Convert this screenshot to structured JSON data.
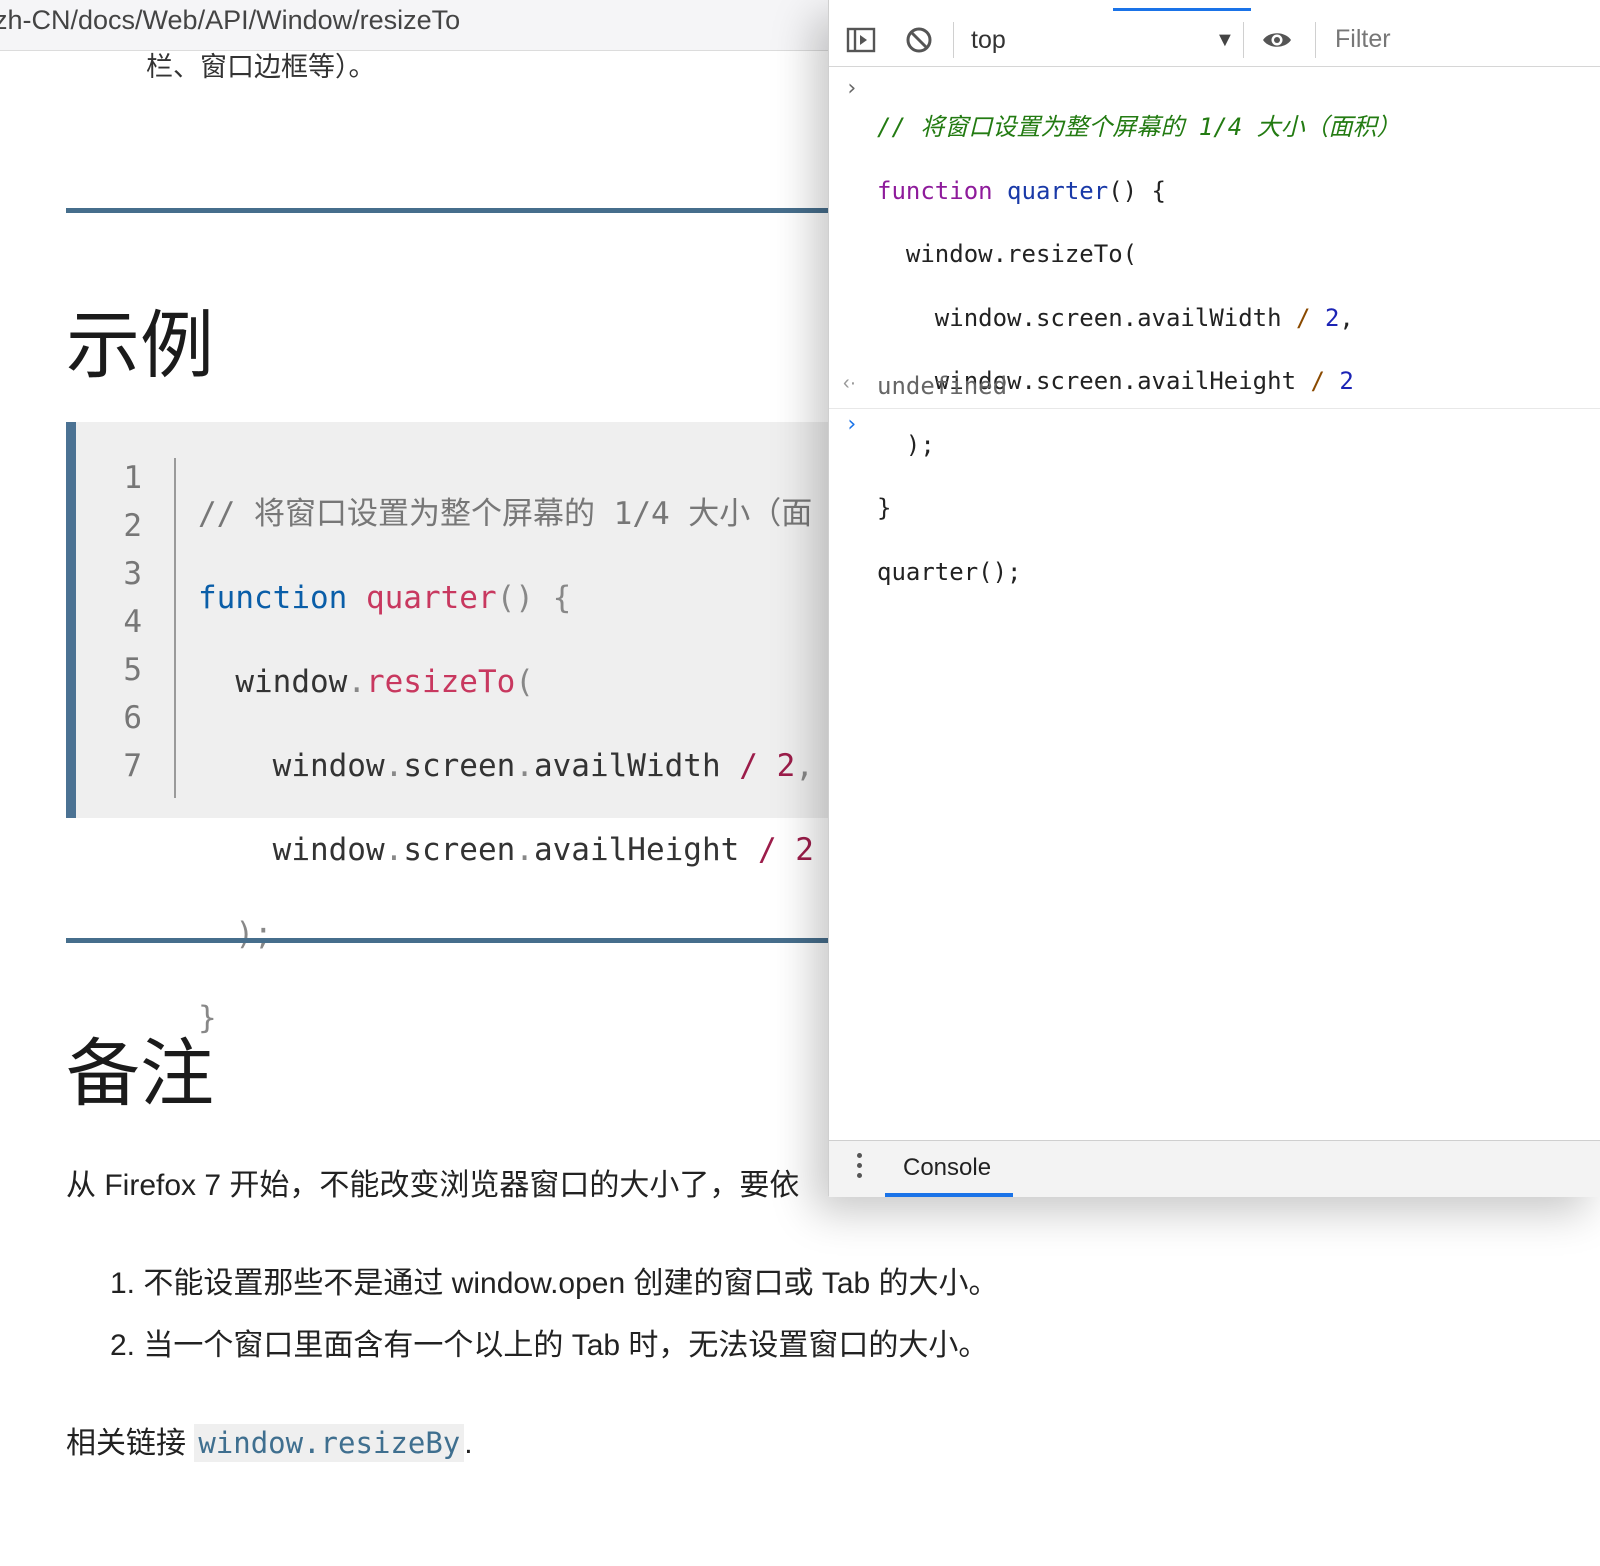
{
  "page": {
    "url": "zh-CN/docs/Web/API/Window/resizeTo",
    "cut_text": "栏、窗口边框等）。",
    "example_heading": "示例",
    "notes_heading": "备注",
    "code_lines": [
      {
        "num": "1"
      },
      {
        "num": "2"
      },
      {
        "num": "3"
      },
      {
        "num": "4"
      },
      {
        "num": "5"
      },
      {
        "num": "6"
      },
      {
        "num": "7"
      }
    ],
    "code_tokens": {
      "l1_comment": "// 将窗口设置为整个屏幕的 1/4 大小（面",
      "l2_kw": "function",
      "l2_fn": "quarter",
      "l2_rest": "() {",
      "l3_obj": "  window",
      "l3_dot": ".",
      "l3_fn": "resizeTo",
      "l3_paren": "(",
      "l4_obj": "    window",
      "l4_prop": "screen",
      "l4_prop2": "availWidth",
      "l4_op": " / ",
      "l4_num": "2",
      "l4_comma": ",",
      "l5_obj": "    window",
      "l5_prop": "screen",
      "l5_prop2": "availHeight",
      "l5_op": " / ",
      "l5_num": "2",
      "l6": "  );",
      "l7": "}"
    },
    "notes_para": "从 Firefox 7 开始，不能改变浏览器窗口的大小了，要依",
    "list_items": [
      "1. 不能设置那些不是通过 window.open 创建的窗口或 Tab 的大小。",
      "2. 当一个窗口里面含有一个以上的 Tab 时，无法设置窗口的大小。"
    ],
    "related_label": "相关链接 ",
    "related_link": "window.resizeBy",
    "related_tail": "."
  },
  "devtools": {
    "context": "top",
    "filter_placeholder": "Filter",
    "console_lines": {
      "c1": "// 将窗口设置为整个屏幕的 1/4 大小（面积）",
      "c2_kw": "function",
      "c2_fn": "quarter",
      "c2_rest": "() {",
      "c3": "  window.resizeTo(",
      "c4_a": "    window.screen.availWidth",
      "c4_op": " / ",
      "c4_num": "2",
      "c4_comma": ",",
      "c5_a": "    window.screen.availHeight",
      "c5_op": " / ",
      "c5_num": "2",
      "c6": "  );",
      "c7": "}",
      "c8": "quarter();"
    },
    "result": "undefined",
    "drawer_tab": "Console"
  },
  "icons": [
    "dock-side-icon",
    "clear-console-icon",
    "dropdown-arrow-icon",
    "eye-icon",
    "kebab-menu-icon"
  ],
  "colors": {
    "accent": "#1a73e8",
    "mdn_rule": "#466e8c"
  }
}
